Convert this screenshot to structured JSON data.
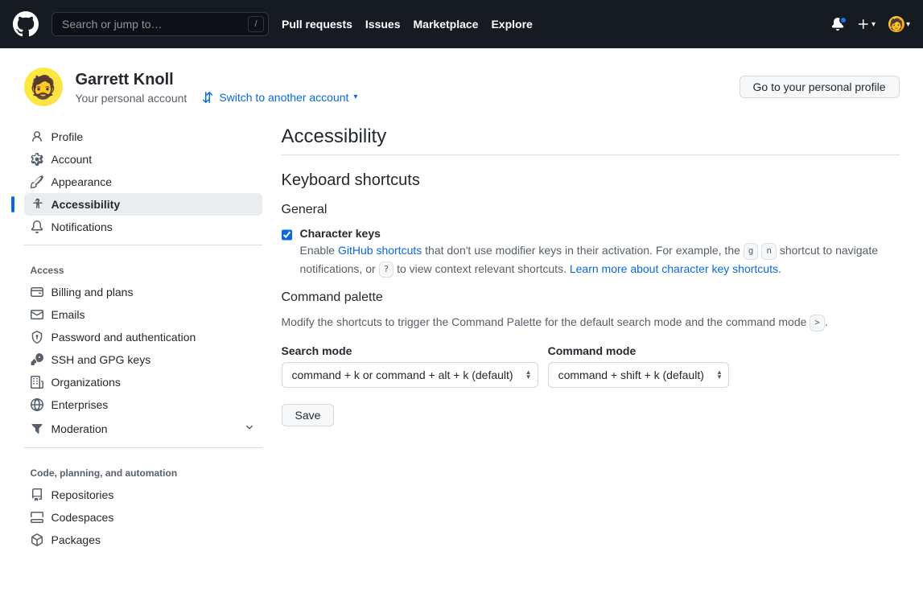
{
  "header": {
    "search_placeholder": "Search or jump to…",
    "nav": [
      "Pull requests",
      "Issues",
      "Marketplace",
      "Explore"
    ]
  },
  "account": {
    "name": "Garrett Knoll",
    "sub": "Your personal account",
    "switch_label": "Switch to another account",
    "profile_button": "Go to your personal profile"
  },
  "sidebar": {
    "top": [
      {
        "label": "Profile"
      },
      {
        "label": "Account"
      },
      {
        "label": "Appearance"
      },
      {
        "label": "Accessibility"
      },
      {
        "label": "Notifications"
      }
    ],
    "access_heading": "Access",
    "access": [
      {
        "label": "Billing and plans"
      },
      {
        "label": "Emails"
      },
      {
        "label": "Password and authentication"
      },
      {
        "label": "SSH and GPG keys"
      },
      {
        "label": "Organizations"
      },
      {
        "label": "Enterprises"
      },
      {
        "label": "Moderation"
      }
    ],
    "code_heading": "Code, planning, and automation",
    "code": [
      {
        "label": "Repositories"
      },
      {
        "label": "Codespaces"
      },
      {
        "label": "Packages"
      }
    ]
  },
  "main": {
    "title": "Accessibility",
    "keyboard_heading": "Keyboard shortcuts",
    "general_heading": "General",
    "char_keys_label": "Character keys",
    "char_keys_desc1": "Enable ",
    "char_keys_link1": "GitHub shortcuts",
    "char_keys_desc2": " that don't use modifier keys in their activation. For example, the ",
    "kbd_g": "g",
    "kbd_n": "n",
    "char_keys_desc3": " shortcut to navigate notifications, or ",
    "kbd_q": "?",
    "char_keys_desc4": " to view context relevant shortcuts. ",
    "char_keys_link2": "Learn more about character key shortcuts.",
    "palette_heading": "Command palette",
    "palette_desc1": "Modify the shortcuts to trigger the Command Palette for the default search mode and the command mode ",
    "kbd_gt": ">",
    "palette_desc2": ".",
    "search_mode_label": "Search mode",
    "search_mode_value": "command + k or command + alt + k (default)",
    "command_mode_label": "Command mode",
    "command_mode_value": "command + shift + k (default)",
    "save_label": "Save"
  }
}
